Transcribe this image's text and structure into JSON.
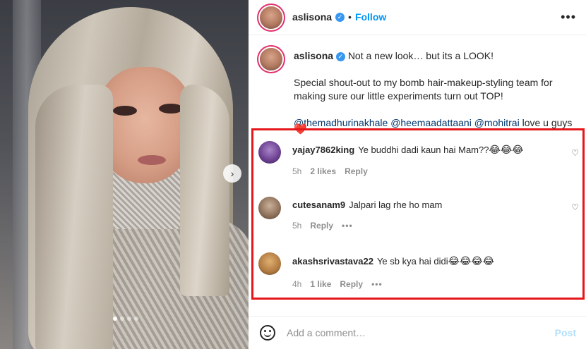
{
  "post": {
    "carousel_dots": 4,
    "active_dot": 0,
    "next_icon": "chevron-right-icon"
  },
  "header": {
    "username": "aslisona",
    "separator": "•",
    "follow_label": "Follow",
    "more_icon": "•••"
  },
  "caption": {
    "username": "aslisona",
    "line1": "Not a new look… but its a LOOK!",
    "line2": "Special shout-out to my bomb hair-makeup-styling team for making sure our little experiments turn out TOP!",
    "mentions": [
      "@themadhurinakhale",
      "@heemaadattaani",
      "@mohitrai"
    ],
    "tail": "love u guys",
    "heart_emoji": "❤️"
  },
  "comments": [
    {
      "username": "yajay7862king",
      "text": "Ye buddhi dadi kaun hai Mam??",
      "emojis": "😂😂😂",
      "time": "5h",
      "likes": "2 likes",
      "reply": "Reply"
    },
    {
      "username": "cutesanam9",
      "text": "Jalpari lag rhe ho mam",
      "emojis": "",
      "time": "5h",
      "reply": "Reply",
      "more": "•••"
    },
    {
      "username": "akashsrivastava22",
      "text": "Ye sb kya hai didi",
      "emojis": "😂😂😂😂",
      "time": "4h",
      "likes": "1 like",
      "reply": "Reply",
      "more": "•••"
    }
  ],
  "comment_box": {
    "placeholder": "Add a comment…",
    "post_label": "Post"
  },
  "colors": {
    "follow_blue": "#0095f6",
    "highlight_red": "#e5171b",
    "mention_blue": "#00376b"
  }
}
